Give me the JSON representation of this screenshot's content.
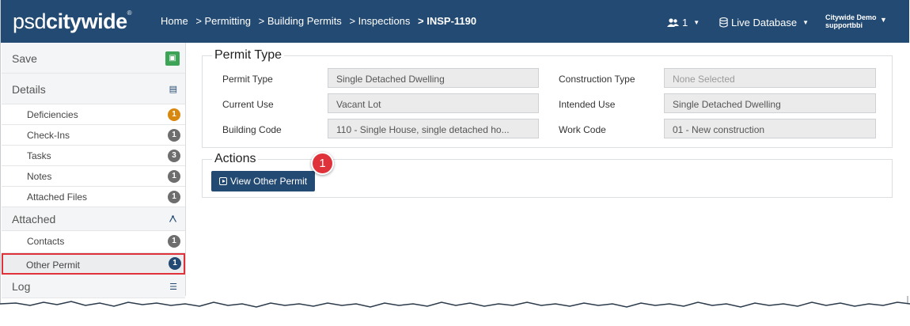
{
  "header": {
    "logo_light": "psd",
    "logo_bold": "citywide",
    "logo_mark": "®",
    "breadcrumbs": [
      "Home",
      "> Permitting",
      "> Building Permits",
      "> Inspections",
      "> INSP-1190"
    ],
    "users_count": "1",
    "database_label": "Live Database",
    "user_org": "Citywide Demo",
    "user_name": "supportbbi"
  },
  "sidebar": {
    "save": "Save",
    "details": "Details",
    "deficiencies": {
      "label": "Deficiencies",
      "count": "1"
    },
    "checkins": {
      "label": "Check-Ins",
      "count": "1"
    },
    "tasks": {
      "label": "Tasks",
      "count": "3"
    },
    "notes": {
      "label": "Notes",
      "count": "1"
    },
    "attached_files": {
      "label": "Attached Files",
      "count": "1"
    },
    "attached": "Attached",
    "contacts": {
      "label": "Contacts",
      "count": "1"
    },
    "other_permit": {
      "label": "Other Permit",
      "count": "1"
    },
    "log": "Log"
  },
  "permit_type": {
    "title": "Permit Type",
    "permit_type_label": "Permit Type",
    "permit_type_value": "Single Detached Dwelling",
    "construction_type_label": "Construction Type",
    "construction_type_value": "None Selected",
    "current_use_label": "Current Use",
    "current_use_value": "Vacant Lot",
    "intended_use_label": "Intended Use",
    "intended_use_value": "Single Detached Dwelling",
    "building_code_label": "Building Code",
    "building_code_value": "110 - Single House, single detached ho...",
    "work_code_label": "Work Code",
    "work_code_value": "01 - New construction"
  },
  "actions": {
    "title": "Actions",
    "view_other_permit": "View Other Permit"
  },
  "callout": "1",
  "colors": {
    "header_bg": "#234a72",
    "badge_gray": "#6e6e6e",
    "badge_orange": "#d8880f",
    "save_green": "#3da356",
    "highlight_red": "#e0323a"
  }
}
